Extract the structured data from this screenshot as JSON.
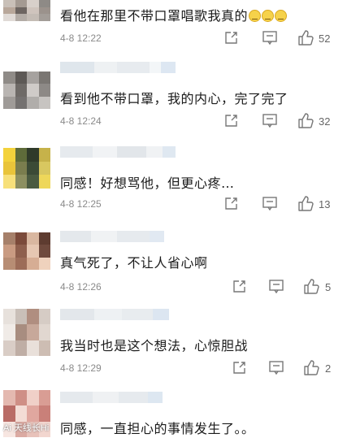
{
  "comments": [
    {
      "text": "看他在那里不带口罩唱歌我真的",
      "emoji_count": 3,
      "time": "4-8 12:22",
      "likes": "52",
      "avatar_colors": [
        "#c9c0b8",
        "#a49a92",
        "#d8d0ca",
        "#8e8a86",
        "#b8a79a",
        "#6d6561",
        "#cfc4bd",
        "#9b928c",
        "#e0dad6",
        "#b3aca6",
        "#c4bcb5",
        "#a39d98"
      ]
    },
    {
      "text": "看到他不带口罩，我的内心，完了完了",
      "time": "4-8 12:24",
      "likes": "32",
      "avatar_colors": [
        "#8f8b87",
        "#5d5956",
        "#a6a29f",
        "#7a7672",
        "#b9b5b2",
        "#6e6a67",
        "#cfcbc8",
        "#8d8986",
        "#9f9b98",
        "#747170",
        "#b0adaa",
        "#c7c4c1"
      ]
    },
    {
      "text": "同感！好想骂他，但更心疼…",
      "time": "4-8 12:25",
      "likes": "13",
      "avatar_colors": [
        "#f3d23c",
        "#5e6b3a",
        "#2f3a2a",
        "#c6b24a",
        "#e9c43a",
        "#7a7d4e",
        "#3b4a36",
        "#d8c760",
        "#f7e07a",
        "#8c8f60",
        "#4a5a40",
        "#eed75a"
      ]
    },
    {
      "text": "真气死了，不让人省心啊",
      "time": "4-8 12:26",
      "likes": "5",
      "avatar_colors": [
        "#a6806a",
        "#7b4a3a",
        "#d9b7a0",
        "#5e3c30",
        "#c99b82",
        "#8e5f4d",
        "#e6c7b2",
        "#6f4a3d",
        "#b78d74",
        "#9c6c58",
        "#d6ad94",
        "#efd2bd"
      ]
    },
    {
      "text": "我当时也是这个想法，心惊胆战",
      "time": "4-8 12:29",
      "likes": "2",
      "avatar_colors": [
        "#e7e1dc",
        "#c9bfb8",
        "#b08e80",
        "#d6ccc5",
        "#f0ebe7",
        "#a88d80",
        "#c7a89a",
        "#e1d7d0",
        "#d9cdc6",
        "#bfae a5",
        "#e9e0da",
        "#cdbdb3"
      ]
    },
    {
      "text": "同感，一直担心的事情发生了。。",
      "time": "",
      "likes": "",
      "avatar_colors": [
        "#e4b9b0",
        "#cf8f86",
        "#f0d0c8",
        "#d99d94",
        "#b96c66",
        "#f3dcd5",
        "#e0a79f",
        "#c98079",
        "#f7e6e1",
        "#dbaaa2",
        "#e8c2ba",
        "#f2d6cf"
      ]
    }
  ],
  "icons": {
    "share": "share-icon",
    "comment": "comment-icon",
    "like": "thumbs-up-icon"
  },
  "watermark": "Ai 天线长Hi"
}
